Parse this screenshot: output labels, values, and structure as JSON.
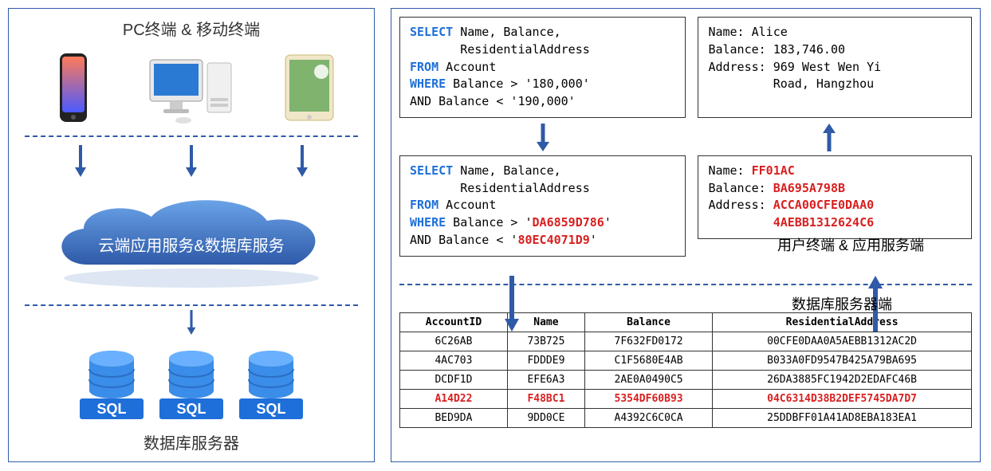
{
  "left": {
    "title_top": "PC终端 & 移动终端",
    "cloud_text": "云端应用服务&数据库服务",
    "db_label": "数据库服务器",
    "sql_label": "SQL"
  },
  "right": {
    "query1": {
      "select_kw": "SELECT",
      "select_cols": " Name, Balance,",
      "select_cols2": "       ResidentialAddress",
      "from_kw": "FROM",
      "from_tbl": " Account",
      "where_kw": "WHERE",
      "where_c1": " Balance > '180,000'",
      "and_c2": "AND Balance < '190,000'"
    },
    "result_plain": {
      "l1": "Name: Alice",
      "l2": "Balance: 183,746.00",
      "l3": "Address: 969 West Wen Yi",
      "l4": "         Road, Hangzhou"
    },
    "query2": {
      "select_kw": "SELECT",
      "select_cols": " Name, Balance,",
      "select_cols2": "       ResidentialAddress",
      "from_kw": "FROM",
      "from_tbl": " Account",
      "where_kw": "WHERE",
      "where_pre": " Balance > '",
      "where_enc1": "DA6859D786",
      "where_post": "'",
      "and_pre": "AND Balance < '",
      "and_enc2": "80EC4071D9",
      "and_post": "'"
    },
    "result_enc": {
      "name_lbl": "Name: ",
      "name_val": "FF01AC",
      "bal_lbl": "Balance: ",
      "bal_val": "BA695A798B",
      "addr_lbl": "Address: ",
      "addr_val1": "ACCA00CFE0DAA0",
      "addr_val2": "4AEBB1312624C6"
    },
    "divider_top": "用户终端 & 应用服务端",
    "divider_bot": "数据库服务器端",
    "table": {
      "headers": [
        "AccountID",
        "Name",
        "Balance",
        "ResidentialAddress"
      ],
      "rows": [
        [
          "6C26AB",
          "73B725",
          "7F632FD0172",
          "00CFE0DAA0A5AEBB1312AC2D"
        ],
        [
          "4AC703",
          "FDDDE9",
          "C1F5680E4AB",
          "B033A0FD9547B425A79BA695"
        ],
        [
          "DCDF1D",
          "EFE6A3",
          "2AE0A0490C5",
          "26DA3885FC1942D2EDAFC46B"
        ],
        [
          "A14D22",
          "F48BC1",
          "5354DF60B93",
          "04C6314D38B2DEF5745DA7D7"
        ],
        [
          "BED9DA",
          "9DD0CE",
          "A4392C6C0CA",
          "25DDBFF01A41AD8EBA183EA1"
        ]
      ],
      "highlight_index": 3
    }
  }
}
